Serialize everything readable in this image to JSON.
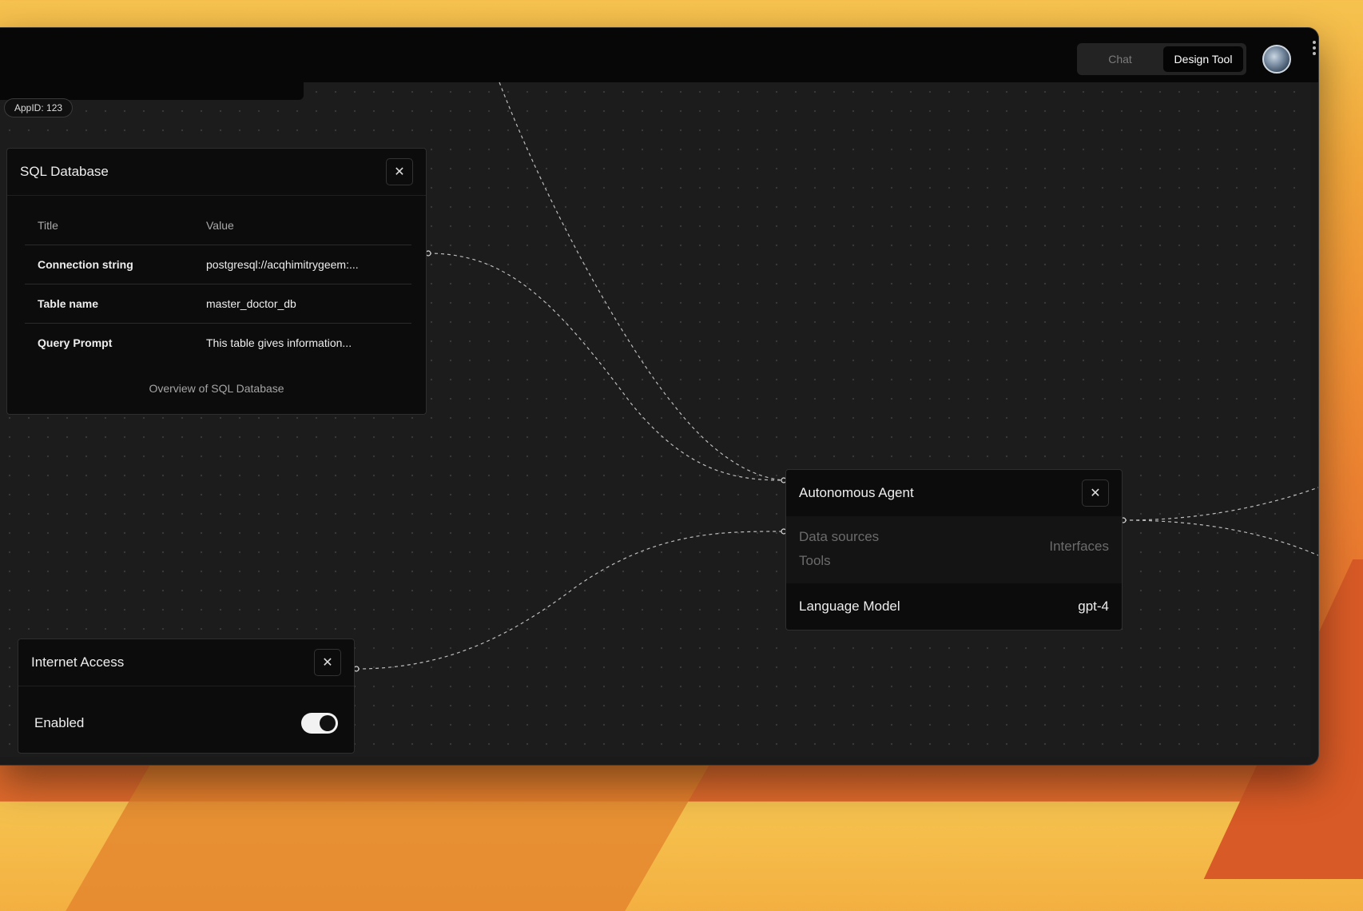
{
  "header": {
    "tabs": [
      {
        "label": "Chat",
        "active": false
      },
      {
        "label": "Design Tool",
        "active": true
      }
    ]
  },
  "app_badge": "AppID: 123",
  "sql_node": {
    "title": "SQL Database",
    "columns": [
      "Title",
      "Value"
    ],
    "rows": [
      {
        "key": "Connection string",
        "value": "postgresql://acqhimitrygeem:..."
      },
      {
        "key": "Table name",
        "value": "master_doctor_db"
      },
      {
        "key": "Query Prompt",
        "value": "This table gives information..."
      }
    ],
    "caption": "Overview of SQL Database"
  },
  "agent_node": {
    "title": "Autonomous Agent",
    "input_ports": [
      "Data sources",
      "Tools"
    ],
    "output_port": "Interfaces",
    "model_label": "Language Model",
    "model_value": "gpt-4"
  },
  "internet_node": {
    "title": "Internet Access",
    "toggle_label": "Enabled",
    "enabled": true
  },
  "icons": [
    "close-icon",
    "avatar"
  ],
  "colors": {
    "accent_bg": "#050505",
    "canvas_bg": "#1c1c1c"
  }
}
